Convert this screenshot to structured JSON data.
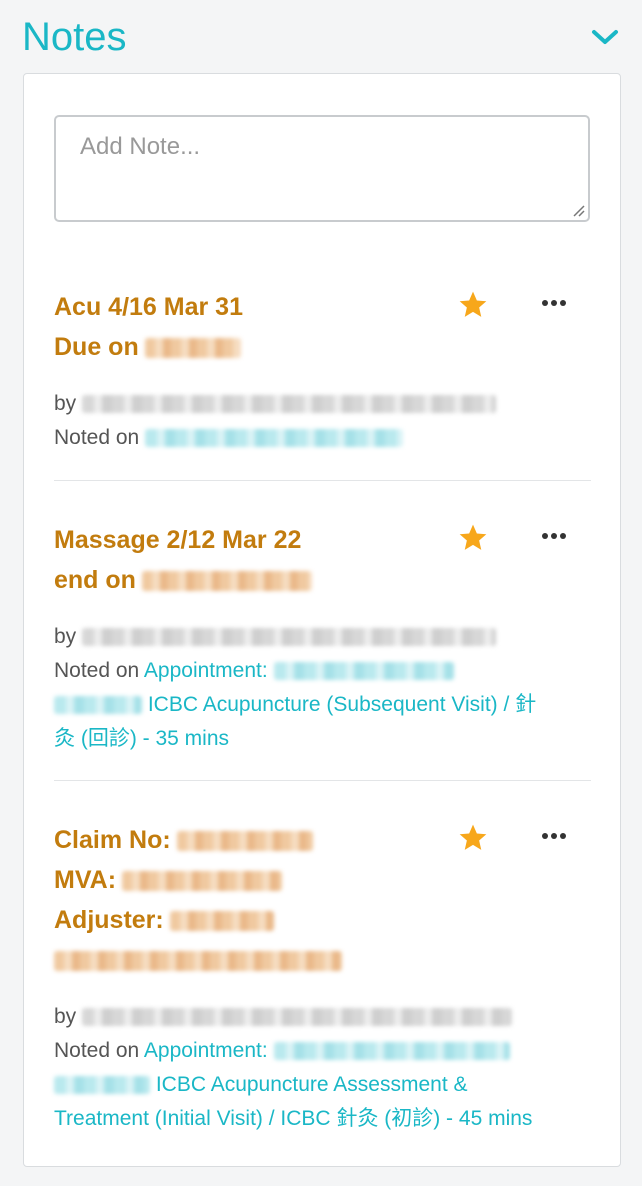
{
  "header": {
    "title": "Notes",
    "collapse_icon": "chevron-down-icon"
  },
  "add_note": {
    "placeholder": "Add Note..."
  },
  "labels": {
    "by": "by",
    "noted_on": "Noted on",
    "appointment": "Appointment:"
  },
  "colors": {
    "accent": "#1ab7c6",
    "note_title": "#c27c0e",
    "star": "#f7a71b"
  },
  "notes": [
    {
      "line1": "Acu 4/16 Mar 31",
      "line2": "Due on",
      "starred": true,
      "noted_on_link": ""
    },
    {
      "line1": "Massage 2/12 Mar 22",
      "line2": "end on",
      "starred": true,
      "noted_on_link": "ICBC Acupuncture (Subsequent Visit) / 針",
      "noted_on_link_2": "灸 (回診) - 35 mins"
    },
    {
      "line1": "Claim No:",
      "line2": "MVA:",
      "line3": "Adjuster:",
      "starred": true,
      "noted_on_link": "ICBC Acupuncture Assessment &",
      "noted_on_link_2": "Treatment (Initial Visit) / ICBC 針灸 (初診) - 45 mins"
    }
  ]
}
